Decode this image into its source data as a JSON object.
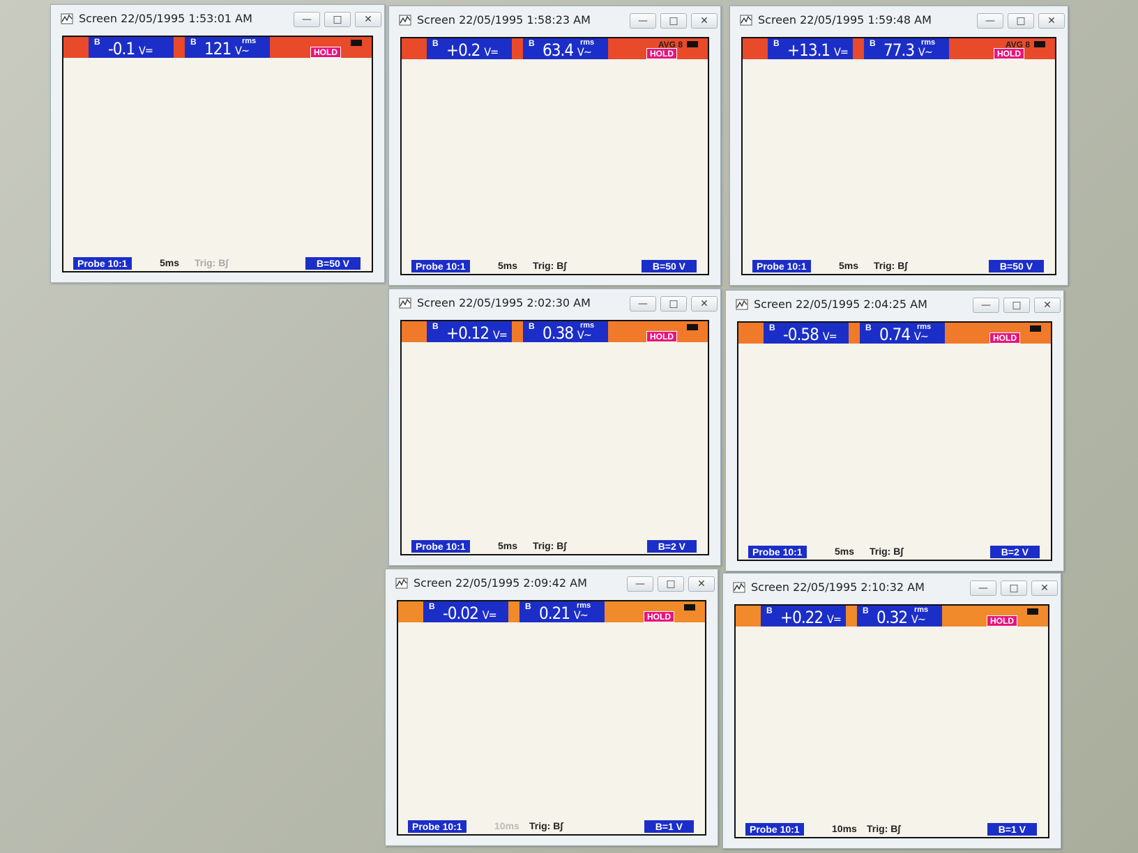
{
  "windows": [
    {
      "title": "Screen  22/05/1995  1:53:01 AM",
      "dc": "-0.1",
      "dc_unit": "V=",
      "rms": "121",
      "rms_unit": "V~",
      "rms_label": "rms",
      "avg": "",
      "hold": "HOLD",
      "probe": "Probe 10:1",
      "timebase": "5ms",
      "trig": "Trig: B∫",
      "scale": "B=50 V",
      "channel": "B",
      "color_bar": "#e84a2a",
      "wave": "sine"
    },
    {
      "title": "Screen  22/05/1995  1:58:23 AM",
      "dc": "+0.2",
      "dc_unit": "V=",
      "rms": "63.4",
      "rms_unit": "V~",
      "rms_label": "rms",
      "avg": "AVG 8",
      "hold": "HOLD",
      "probe": "Probe 10:1",
      "timebase": "5ms",
      "trig": "Trig: B∫",
      "scale": "B=50 V",
      "channel": "B",
      "color_bar": "#e84a2a",
      "wave": "pulse"
    },
    {
      "title": "Screen  22/05/1995  1:59:48 AM",
      "dc": "+13.1",
      "dc_unit": "V=",
      "rms": "77.3",
      "rms_unit": "V~",
      "rms_label": "rms",
      "avg": "AVG 8",
      "hold": "HOLD",
      "probe": "Probe 10:1",
      "timebase": "5ms",
      "trig": "Trig: B∫",
      "scale": "B=50 V",
      "channel": "B",
      "color_bar": "#e84a2a",
      "wave": "pulse2"
    },
    {
      "title": "Screen  22/05/1995  2:02:30 AM",
      "dc": "+0.12",
      "dc_unit": "V=",
      "rms": "0.38",
      "rms_unit": "V~",
      "rms_label": "rms",
      "avg": "",
      "hold": "HOLD",
      "probe": "Probe 10:1",
      "timebase": "5ms",
      "trig": "Trig: B∫",
      "scale": "B=2 V",
      "channel": "B",
      "color_bar": "#f07a2a",
      "wave": "noise1"
    },
    {
      "title": "Screen  22/05/1995  2:04:25 AM",
      "dc": "-0.58",
      "dc_unit": "V=",
      "rms": "0.74",
      "rms_unit": "V~",
      "rms_label": "rms",
      "avg": "",
      "hold": "HOLD",
      "probe": "Probe 10:1",
      "timebase": "5ms",
      "trig": "Trig: B∫",
      "scale": "B=2 V",
      "channel": "B",
      "color_bar": "#f07a2a",
      "wave": "noise2"
    },
    {
      "title": "Screen  22/05/1995  2:09:42 AM",
      "dc": "-0.02",
      "dc_unit": "V=",
      "rms": "0.21",
      "rms_unit": "V~",
      "rms_label": "rms",
      "avg": "",
      "hold": "HOLD",
      "probe": "Probe 10:1",
      "timebase": "10ms",
      "trig": "Trig: B∫",
      "scale": "B=1 V",
      "channel": "B",
      "color_bar": "#f08a2a",
      "wave": "noise3"
    },
    {
      "title": "Screen  22/05/1995  2:10:32 AM",
      "dc": "+0.22",
      "dc_unit": "V=",
      "rms": "0.32",
      "rms_unit": "V~",
      "rms_label": "rms",
      "avg": "",
      "hold": "HOLD",
      "probe": "Probe 10:1",
      "timebase": "10ms",
      "trig": "Trig: B∫",
      "scale": "B=1 V",
      "channel": "B",
      "color_bar": "#f08a2a",
      "wave": "noise4"
    }
  ],
  "buttons": {
    "minimize": "—",
    "maximize": "□",
    "close": "✕"
  },
  "colors": {
    "trace": "#2630b8",
    "grid": "#8a8a8a",
    "readout": "#1c2ec8",
    "hold": "#e8147c"
  }
}
